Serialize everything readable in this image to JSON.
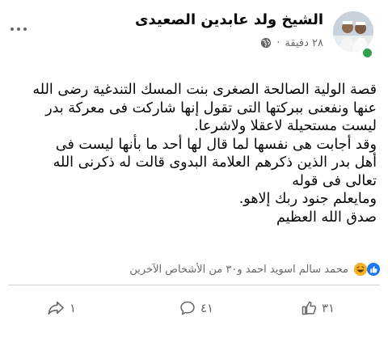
{
  "post": {
    "author": "الشيخ ولد عابدين الصعيدى",
    "time": "٢٨ دقيقة",
    "separator": "·",
    "privacy_icon": "globe-icon",
    "body_lines": [
      "قصة الولية الصالحة الصغرى بنت المسك التندغية رضى الله",
      "عنها ونفعنى ببركتها التى تقول إنها شاركت فى معركة بدر",
      "ليست مستحيلة لاعقلا ولاشرعا.",
      "وقد أجابت هى نفسها لما قال لها أحد ما بأنها ليست فى",
      "أهل بدر الذين ذكرهم العلامة البدوى قالت له ذكرنى الله",
      "تعالى فى قوله",
      "ومايعلم جنود ربك إلاهو.",
      "صدق الله العظيم"
    ]
  },
  "reactions": {
    "summary": "محمد سالم اسويد احمد و٣٠ من الأشخاص الآخرين",
    "icons": [
      "like-icon",
      "haha-icon"
    ],
    "colors": {
      "like": "#1877f2",
      "haha": "#f7b125"
    }
  },
  "actions": {
    "like_count": "٣١",
    "comment_count": "٤١",
    "share_count": "١"
  },
  "online_color": "#31a24c"
}
